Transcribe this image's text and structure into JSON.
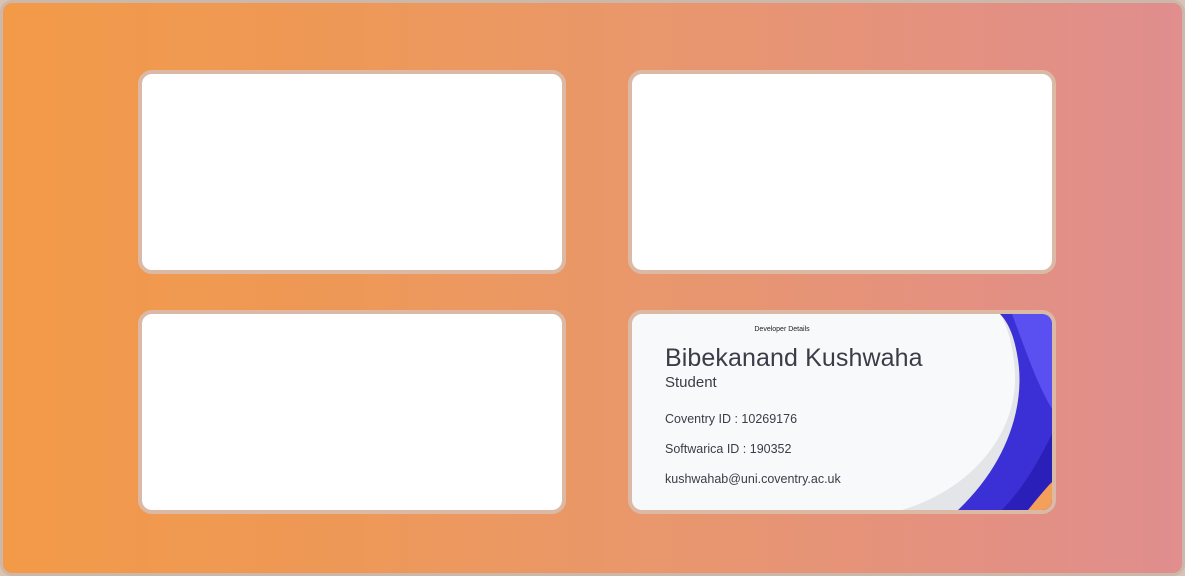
{
  "cards": {
    "top_left": {},
    "top_right": {},
    "bottom_left": {},
    "developer": {
      "heading": "Developer Details",
      "name": "Bibekanand Kushwaha",
      "role": "Student",
      "coventry_id": "Coventry ID : 10269176",
      "softwarica_id": "Softwarica ID : 190352",
      "email": "kushwahab@uni.coventry.ac.uk"
    }
  },
  "colors": {
    "background_start": "#f29a48",
    "background_end": "#e08e8e",
    "card_border": "#dcb9a5",
    "card_fill": "#ffffff",
    "accent_blue": "#3b2fd6",
    "accent_orange": "#f5a05a"
  }
}
